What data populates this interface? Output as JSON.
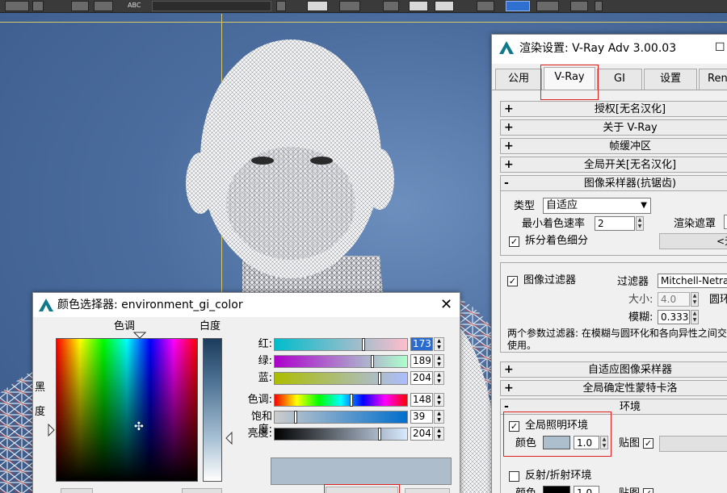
{
  "toolbar": {
    "abc_label": "ABC"
  },
  "render_dialog": {
    "title": "渲染设置: V-Ray Adv 3.00.03",
    "tabs": [
      "公用",
      "V-Ray",
      "GI",
      "设置",
      "Ren"
    ],
    "active_tab": "V-Ray",
    "rollouts_top": [
      {
        "sign": "+",
        "label": "授权[无名汉化]"
      },
      {
        "sign": "+",
        "label": "关于 V-Ray"
      },
      {
        "sign": "+",
        "label": "帧缓冲区"
      },
      {
        "sign": "+",
        "label": "全局开关[无名汉化]"
      },
      {
        "sign": "-",
        "label": "图像采样器(抗锯齿)"
      }
    ],
    "image_sampler": {
      "type_label": "类型",
      "type_value": "自适应",
      "min_shading_rate_label": "最小着色速率",
      "min_shading_rate_value": "2",
      "render_mask_label": "渲染遮罩",
      "split_shading_label": "拆分着色细分",
      "split_shading_checked": true,
      "button_partial": "<无"
    },
    "image_filter": {
      "checkbox_label": "图像过滤器",
      "checked": true,
      "filter_label": "过滤器",
      "filter_value": "Mitchell-Netravali",
      "size_label": "大小:",
      "size_value": "4.0",
      "ring_label": "圆环",
      "blur_label": "模糊:",
      "blur_value": "0.333",
      "description": "两个参数过滤器: 在模糊与圆环化和各向异性之间交替使用。"
    },
    "rollouts_mid": [
      {
        "sign": "+",
        "label": "自适应图像采样器"
      },
      {
        "sign": "+",
        "label": "全局确定性蒙特卡洛"
      },
      {
        "sign": "-",
        "label": "环境"
      }
    ],
    "environment": {
      "gi_env_label": "全局照明环境",
      "gi_env_checked": true,
      "color_label": "颜色",
      "color_swatch": "#adbfcc",
      "multiplier_value": "1.0",
      "map_label": "贴图",
      "map_checked": true,
      "refl_label": "反射/折射环境",
      "refl_checked": false,
      "color_label_2": "颜色",
      "multiplier_value_2": "1.0",
      "map_label_2": "贴图",
      "map_checked_2": true
    }
  },
  "color_picker": {
    "title": "颜色选择器: environment_gi_color",
    "hue_label": "色调",
    "whiteness_label": "白度",
    "blackness_label_1": "黑",
    "blackness_label_2": "度",
    "sliders": [
      {
        "label": "红:",
        "value": "173",
        "level": 0.678
      },
      {
        "label": "绿:",
        "value": "189",
        "level": 0.741
      },
      {
        "label": "蓝:",
        "value": "204",
        "level": 0.8
      },
      {
        "label": "色调:",
        "value": "148",
        "level": 0.58
      },
      {
        "label": "饱和度:",
        "value": "39",
        "level": 0.153
      },
      {
        "label": "亮度:",
        "value": "204",
        "level": 0.8
      }
    ],
    "preview_color": "#adbdcc"
  }
}
